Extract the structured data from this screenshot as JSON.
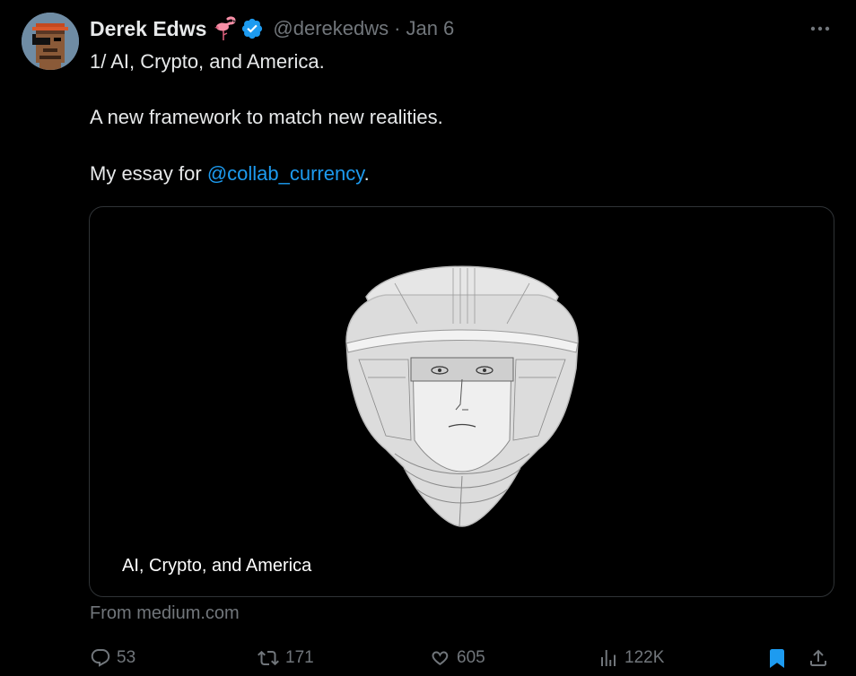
{
  "author": {
    "display_name": "Derek Edws",
    "name_emoji": "flamingo-emoji",
    "verified_icon": "verified-badge-icon",
    "handle": "@derekedws",
    "separator": "·",
    "date": "Jan 6"
  },
  "tweet": {
    "line1": "1/ AI, Crypto, and America.",
    "line2": "A new framework to match new realities.",
    "line3_prefix": "My essay for ",
    "line3_mention": "@collab_currency",
    "line3_suffix": "."
  },
  "card": {
    "title": "AI, Crypto, and America",
    "image": "astronaut-helmet-sketch",
    "source": "From medium.com"
  },
  "actions": {
    "replies": "53",
    "retweets": "171",
    "likes": "605",
    "views": "122K",
    "bookmarked": true
  },
  "colors": {
    "background": "#000000",
    "text_primary": "#e7e9ea",
    "text_secondary": "#71767b",
    "accent": "#1d9bf0",
    "border": "#2f3336"
  }
}
